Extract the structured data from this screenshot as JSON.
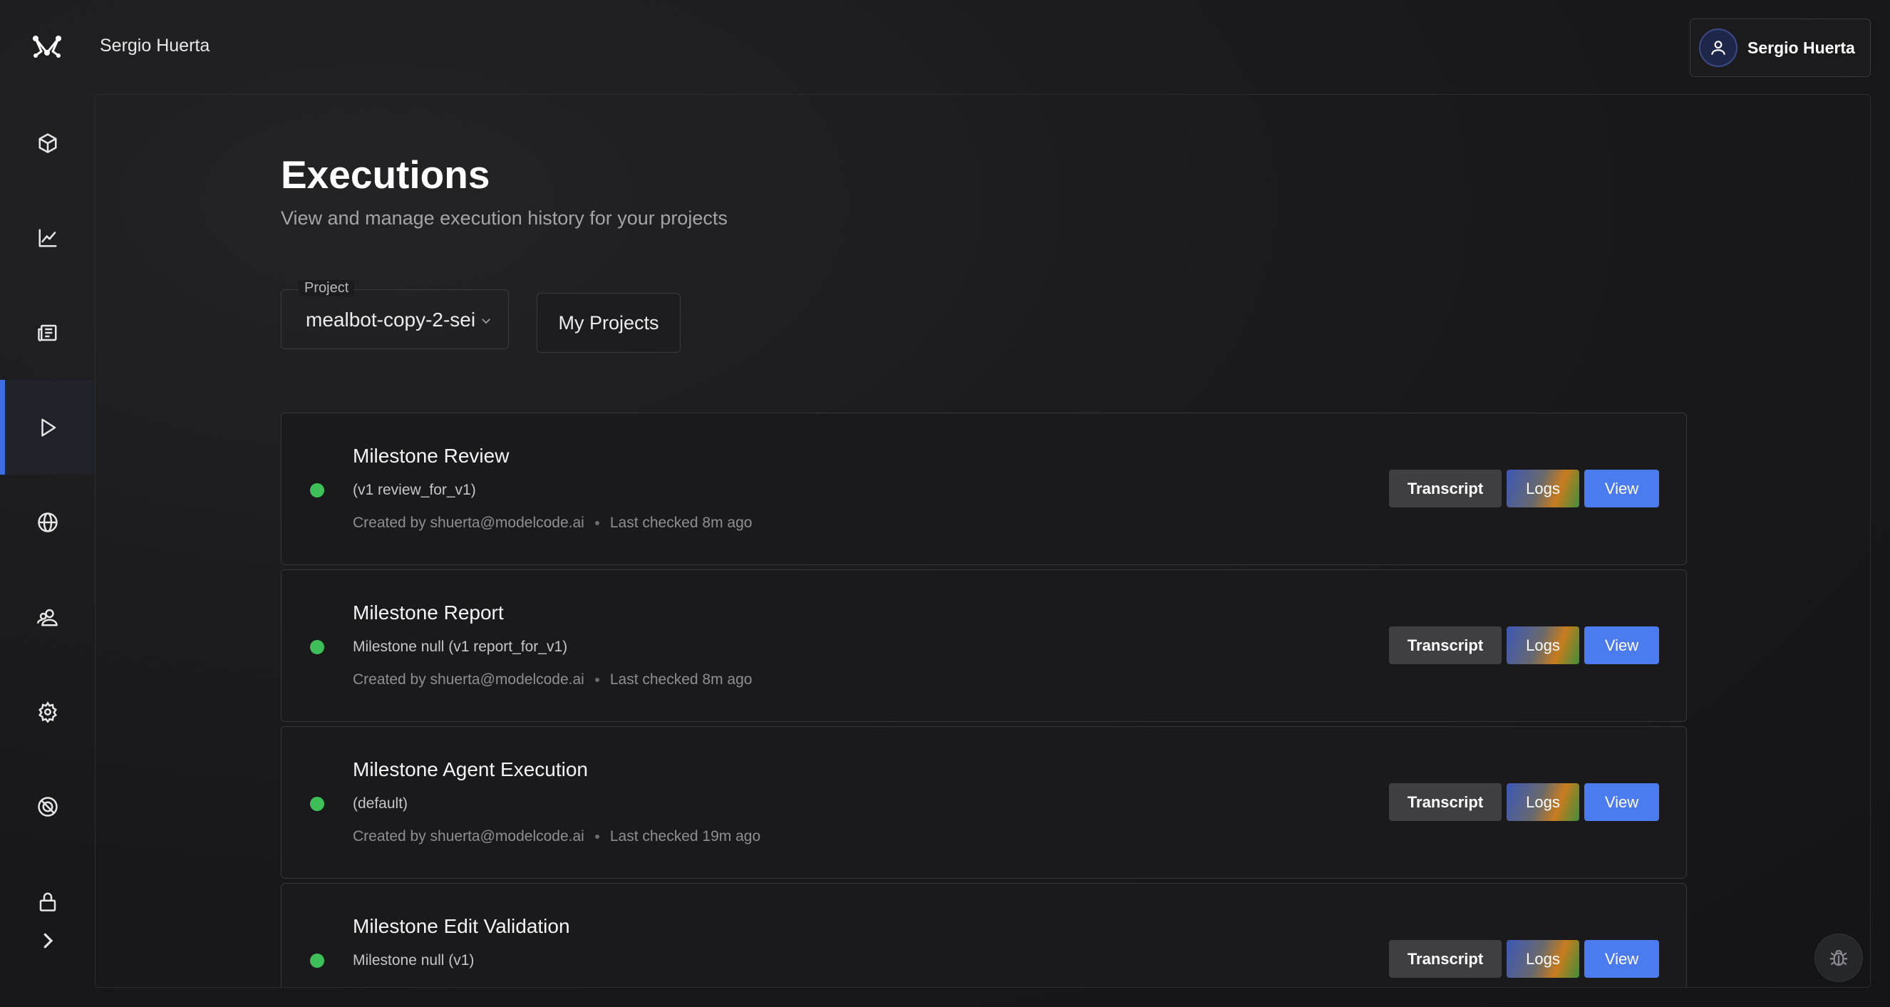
{
  "header": {
    "user_name": "Sergio Huerta",
    "user_button_label": "Sergio Huerta"
  },
  "sidebar": {
    "items": [
      {
        "icon": "cube-icon",
        "active": false
      },
      {
        "icon": "chart-icon",
        "active": false
      },
      {
        "icon": "newspaper-icon",
        "active": false
      },
      {
        "icon": "play-icon",
        "active": true
      },
      {
        "icon": "globe-icon",
        "active": false
      },
      {
        "icon": "users-icon",
        "active": false
      },
      {
        "icon": "gear-icon",
        "active": false
      },
      {
        "icon": "ban-icon",
        "active": false
      },
      {
        "icon": "lock-icon",
        "active": false
      },
      {
        "icon": "chevron-right-icon",
        "active": false
      }
    ],
    "accent": "#3d6fe0"
  },
  "main": {
    "title": "Executions",
    "subtitle": "View and manage execution history for your projects",
    "project_select": {
      "label": "Project",
      "value": "mealbot-copy-2-sei"
    },
    "my_projects_label": "My Projects",
    "executions": [
      {
        "title": "Milestone Review",
        "subtitle": "(v1 review_for_v1)",
        "created_by": "Created by shuerta@modelcode.ai",
        "last_checked": "Last checked 8m ago",
        "status_color": "#3fbf5a"
      },
      {
        "title": "Milestone Report",
        "subtitle": "Milestone null (v1 report_for_v1)",
        "created_by": "Created by shuerta@modelcode.ai",
        "last_checked": "Last checked 8m ago",
        "status_color": "#3fbf5a"
      },
      {
        "title": "Milestone Agent Execution",
        "subtitle": "(default)",
        "created_by": "Created by shuerta@modelcode.ai",
        "last_checked": "Last checked 19m ago",
        "status_color": "#3fbf5a"
      },
      {
        "title": "Milestone Edit Validation",
        "subtitle": "Milestone null (v1)",
        "status_color": "#3fbf5a"
      }
    ],
    "buttons": {
      "transcript": "Transcript",
      "logs": "Logs",
      "view": "View"
    }
  },
  "colors": {
    "view_button": "#4a7cf0",
    "status_ok": "#3fbf5a"
  }
}
